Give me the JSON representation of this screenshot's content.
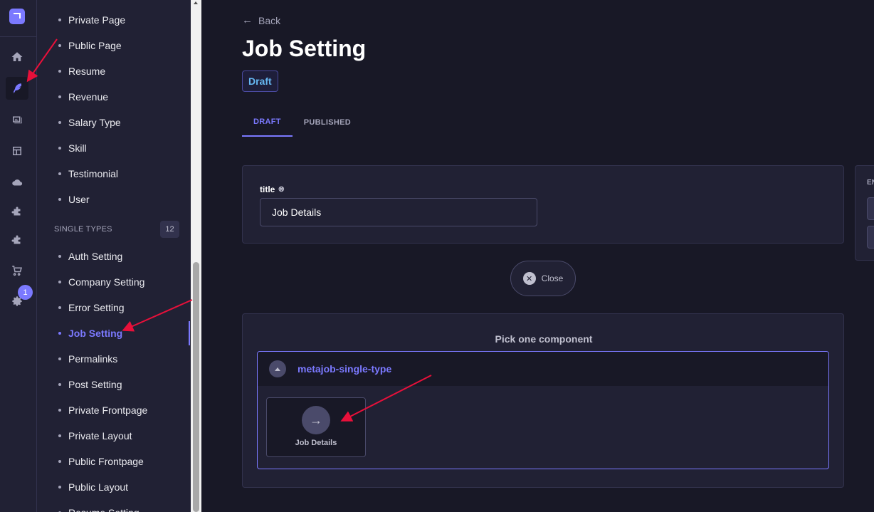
{
  "rail": {
    "icons": [
      "logo-icon",
      "home-icon",
      "content-manager-icon",
      "media-library-icon",
      "layout-icon",
      "cloud-icon",
      "puzzle-icon",
      "puzzle-icon",
      "cart-icon",
      "settings-icon"
    ],
    "settings_badge": "1"
  },
  "subnav": {
    "collection_items": [
      "Private Page",
      "Public Page",
      "Resume",
      "Revenue",
      "Salary Type",
      "Skill",
      "Testimonial",
      "User"
    ],
    "single_types_label": "SINGLE TYPES",
    "single_types_count": "12",
    "single_items": [
      "Auth Setting",
      "Company Setting",
      "Error Setting",
      "Job Setting",
      "Permalinks",
      "Post Setting",
      "Private Frontpage",
      "Private Layout",
      "Public Frontpage",
      "Public Layout",
      "Resume Setting"
    ],
    "active_item": "Job Setting"
  },
  "main": {
    "back_label": "Back",
    "title": "Job Setting",
    "status": "Draft",
    "tabs": [
      {
        "label": "DRAFT",
        "active": true
      },
      {
        "label": "PUBLISHED",
        "active": false
      }
    ],
    "field": {
      "label": "title",
      "value": "Job Details"
    },
    "side_panel_label": "EN",
    "close_label": "Close",
    "picker_title": "Pick one component",
    "category_name": "metajob-single-type",
    "component_label": "Job Details"
  },
  "colors": {
    "accent": "#7b79ff",
    "annotation_arrow": "#e8103a",
    "background": "#181826",
    "panel": "#212134"
  }
}
